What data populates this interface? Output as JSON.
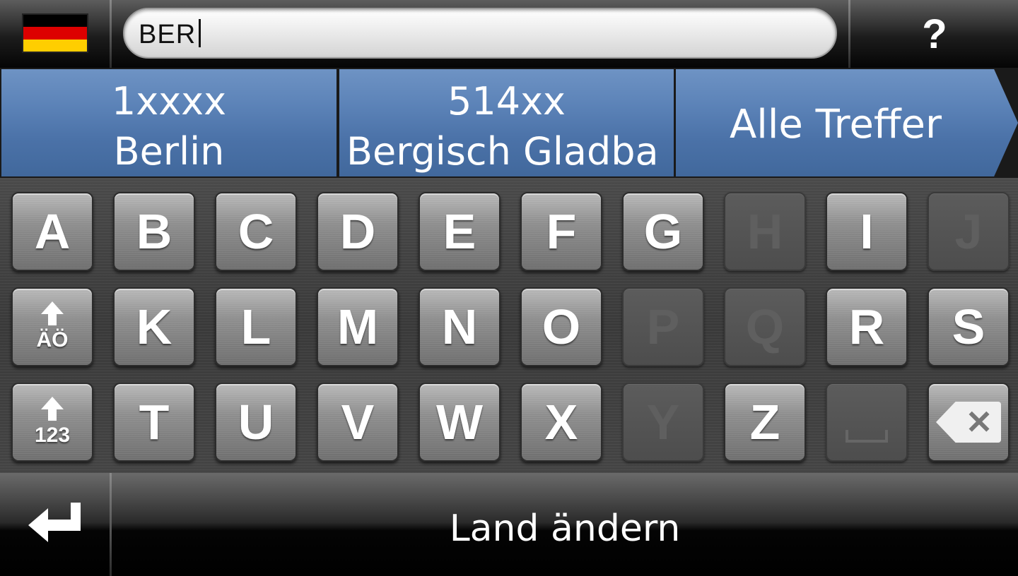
{
  "topbar": {
    "flag": {
      "name": "germany-flag",
      "colors": [
        "#000000",
        "#DD0000",
        "#FFCE00"
      ]
    },
    "search": {
      "value": "BER"
    },
    "help_label": "?"
  },
  "suggestions": [
    {
      "code": "1xxxx",
      "city": "Berlin"
    },
    {
      "code": "514xx",
      "city": "Bergisch Gladba"
    }
  ],
  "all_results_label": "Alle Treffer",
  "keyboard": {
    "rows": [
      [
        {
          "label": "A",
          "enabled": true
        },
        {
          "label": "B",
          "enabled": true
        },
        {
          "label": "C",
          "enabled": true
        },
        {
          "label": "D",
          "enabled": true
        },
        {
          "label": "E",
          "enabled": true
        },
        {
          "label": "F",
          "enabled": true
        },
        {
          "label": "G",
          "enabled": true
        },
        {
          "label": "H",
          "enabled": false
        },
        {
          "label": "I",
          "enabled": true
        },
        {
          "label": "J",
          "enabled": false
        }
      ],
      [
        {
          "label": "ÄÖ",
          "type": "shift-umlaut",
          "enabled": true
        },
        {
          "label": "K",
          "enabled": true
        },
        {
          "label": "L",
          "enabled": true
        },
        {
          "label": "M",
          "enabled": true
        },
        {
          "label": "N",
          "enabled": true
        },
        {
          "label": "O",
          "enabled": true
        },
        {
          "label": "P",
          "enabled": false
        },
        {
          "label": "Q",
          "enabled": false
        },
        {
          "label": "R",
          "enabled": true
        },
        {
          "label": "S",
          "enabled": true
        }
      ],
      [
        {
          "label": "123",
          "type": "shift-numeric",
          "enabled": true
        },
        {
          "label": "T",
          "enabled": true
        },
        {
          "label": "U",
          "enabled": true
        },
        {
          "label": "V",
          "enabled": true
        },
        {
          "label": "W",
          "enabled": true
        },
        {
          "label": "X",
          "enabled": true
        },
        {
          "label": "Y",
          "enabled": false
        },
        {
          "label": "Z",
          "enabled": true
        },
        {
          "label": "",
          "type": "space",
          "enabled": false
        },
        {
          "label": "",
          "type": "backspace",
          "enabled": true
        }
      ]
    ]
  },
  "bottombar": {
    "back_icon": "return-arrow-icon",
    "change_country_label": "Land ändern"
  },
  "colors": {
    "suggestion_blue": "#5b82b7",
    "key_face": "#8e8e8e",
    "key_disabled": "#555555"
  }
}
